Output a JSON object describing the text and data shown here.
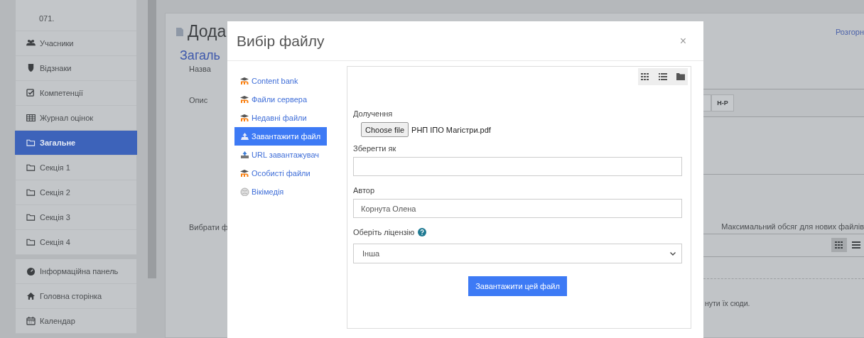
{
  "sidebar": {
    "groups": [
      {
        "items": [
          {
            "label": "071.",
            "kind": "course",
            "selected": false
          },
          {
            "label": "Учасники",
            "kind": "participants",
            "selected": false
          },
          {
            "label": "Відзнаки",
            "kind": "badges",
            "selected": false
          },
          {
            "label": "Компетенції",
            "kind": "competencies",
            "selected": false
          },
          {
            "label": "Журнал оцінок",
            "kind": "grades",
            "selected": false
          },
          {
            "label": "Загальне",
            "kind": "section",
            "selected": true
          },
          {
            "label": "Секція 1",
            "kind": "section",
            "selected": false
          },
          {
            "label": "Секція 2",
            "kind": "section",
            "selected": false
          },
          {
            "label": "Секція 3",
            "kind": "section",
            "selected": false
          },
          {
            "label": "Секція 4",
            "kind": "section",
            "selected": false
          }
        ]
      },
      {
        "items": [
          {
            "label": "Інформаційна панель",
            "kind": "dashboard",
            "selected": false
          },
          {
            "label": "Головна сторінка",
            "kind": "home",
            "selected": false
          },
          {
            "label": "Календар",
            "kind": "calendar",
            "selected": false
          }
        ]
      }
    ]
  },
  "page": {
    "title": "Дода",
    "expand_link": "Розгорн",
    "section_title": "Загаль",
    "name_label": "Назва",
    "description_label": "Опис",
    "editor_button": "Н-Р",
    "file_label": "Вибрати ф",
    "max_size_note": "Максимальний обсяг для нових файлів",
    "drop_hint": "нути їх сюди."
  },
  "dialog": {
    "title": "Вибір файлу",
    "close": "×",
    "repositories": [
      {
        "label": "Content bank",
        "kind": "moodle",
        "selected": false
      },
      {
        "label": "Файли сервера",
        "kind": "moodle",
        "selected": false
      },
      {
        "label": "Недавні файли",
        "kind": "moodle",
        "selected": false
      },
      {
        "label": "Завантажити файл",
        "kind": "upload",
        "selected": true
      },
      {
        "label": "URL завантажувач",
        "kind": "url",
        "selected": false
      },
      {
        "label": "Особисті файли",
        "kind": "moodle",
        "selected": false
      },
      {
        "label": "Вікімедія",
        "kind": "wiki",
        "selected": false
      }
    ],
    "form": {
      "attachment_label": "Долучення",
      "choose_button": "Choose file",
      "chosen_file": "РНП ІПО Магістри.pdf",
      "save_as_label": "Зберегти як",
      "author_label": "Автор",
      "author_value": "Корнута Олена",
      "license_label": "Оберіть ліцензію",
      "license_value": "Інша",
      "submit": "Завантажити цей файл"
    }
  }
}
